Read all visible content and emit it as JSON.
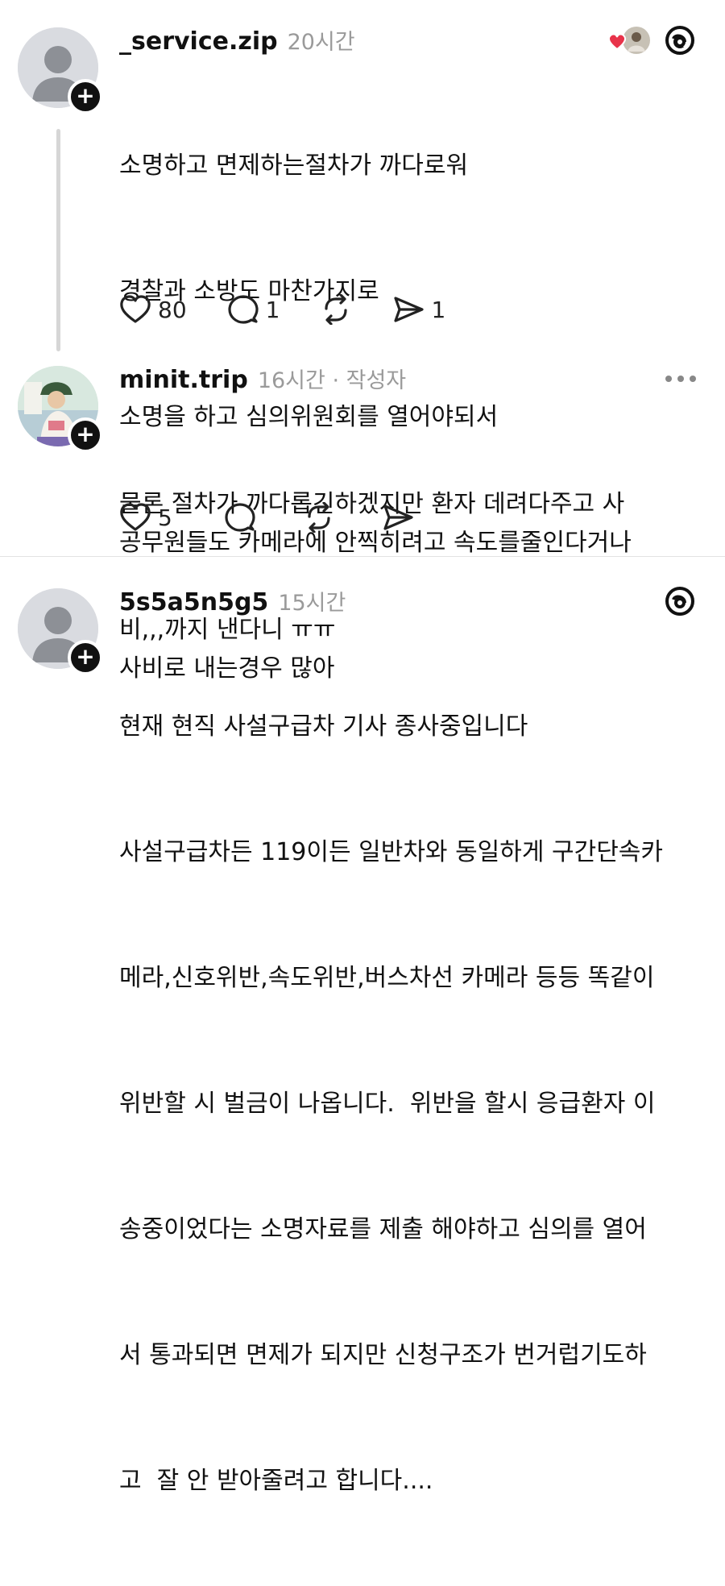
{
  "posts": [
    {
      "username": "_service.zip",
      "time": "20시간",
      "lines": [
        "소명하고 면제하는절차가 까다로워",
        "경찰과 소방도 마찬가지로",
        "소명을 하고 심의위원회를 열어야되서",
        "공무원들도 카메라에 안찍히려고 속도를줄인다거나",
        "사비로 내는경우 많아"
      ],
      "likes": "80",
      "comments": "1",
      "shares": "1"
    },
    {
      "username": "minit.trip",
      "time": "16시간 · 작성자",
      "lines": [
        "물론 절차가 까다롭긴하겠지만 환자 데려다주고 사",
        "비,,,까지 낸다니 ㅠㅠ"
      ],
      "likes": "5"
    },
    {
      "username": "5s5a5n5g5",
      "time": "15시간",
      "lines": [
        "현재 현직 사설구급차 기사 종사중입니다",
        "사설구급차든 119이든 일반차와 동일하게 구간단속카",
        "메라,신호위반,속도위반,버스차선 카메라 등등 똑같이",
        "위반할 시 벌금이 나옵니다.  위반을 할시 응급환자 이",
        "송중이었다는 소명자료를 제출 해야하고 심의를 열어",
        "서 통과되면 면제가 되지만 신청구조가 번거럽기도하",
        "고  잘 안 받아줄려고 합니다...."
      ]
    }
  ],
  "colors": {
    "like_heart": "#e8334a",
    "badge": "#111111",
    "muted": "#9a9a9a"
  }
}
